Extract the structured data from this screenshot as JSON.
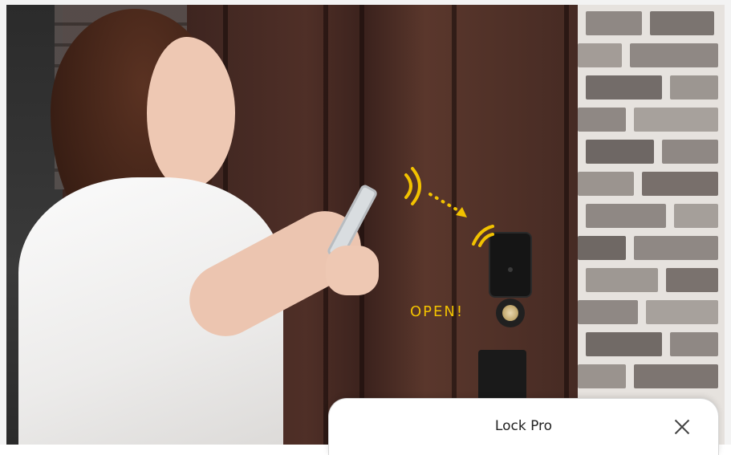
{
  "scene": {
    "open_label": "OPEN!",
    "signal_color": "#f2c200"
  },
  "dialog": {
    "title": "Lock Pro",
    "close_icon": "close-icon"
  }
}
